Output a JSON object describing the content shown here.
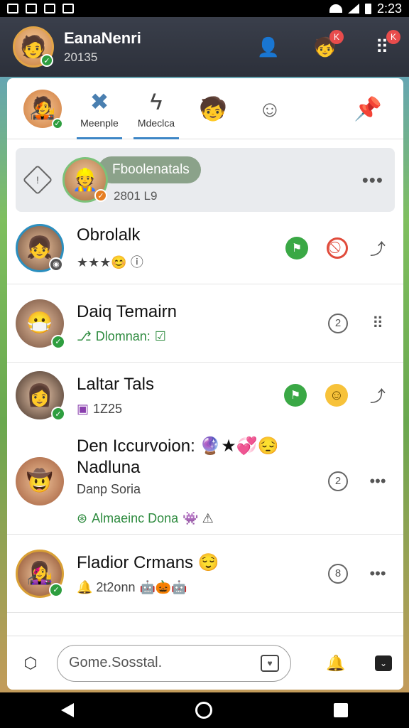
{
  "status": {
    "time": "2:23"
  },
  "header": {
    "title": "EanaNenri",
    "subtitle": "20135",
    "notif_badge": "K",
    "menu_badge": "K"
  },
  "tabs": [
    {
      "label": "Meenple",
      "icon": "cross-swords-icon",
      "active": true
    },
    {
      "label": "Mdeclca",
      "icon": "lightning-icon",
      "active": false
    }
  ],
  "pinned": {
    "name": "Fboolenatals",
    "sub": "2801 L9"
  },
  "chats": [
    {
      "name": "Obrolalk",
      "sub": "★★★😊 ⓘ"
    },
    {
      "name": "Daiq  Temairn",
      "sub_icon": "⎇",
      "sub": "Dlomnan:",
      "sub_badge": "☑",
      "action_label": "2"
    },
    {
      "name": "Laltar Tals",
      "sub_icon": "▣",
      "sub": "1Z25"
    },
    {
      "name": "Den Iccurvoion: 🔮★💞😔",
      "name2": "Nadluna",
      "sub1": "Danp Soria",
      "sub2_icon": "⊛",
      "sub2": "Almaeinc Dona",
      "sub2_emoji": "👾 ⚠",
      "action_label": "2"
    },
    {
      "name": "Fladior Crmans 😌",
      "sub": "🔔 2t2onn",
      "sub_emoji": "🤖🎃🤖",
      "action_label": "8"
    }
  ],
  "compose": {
    "placeholder": "Gome.Sosstal."
  }
}
